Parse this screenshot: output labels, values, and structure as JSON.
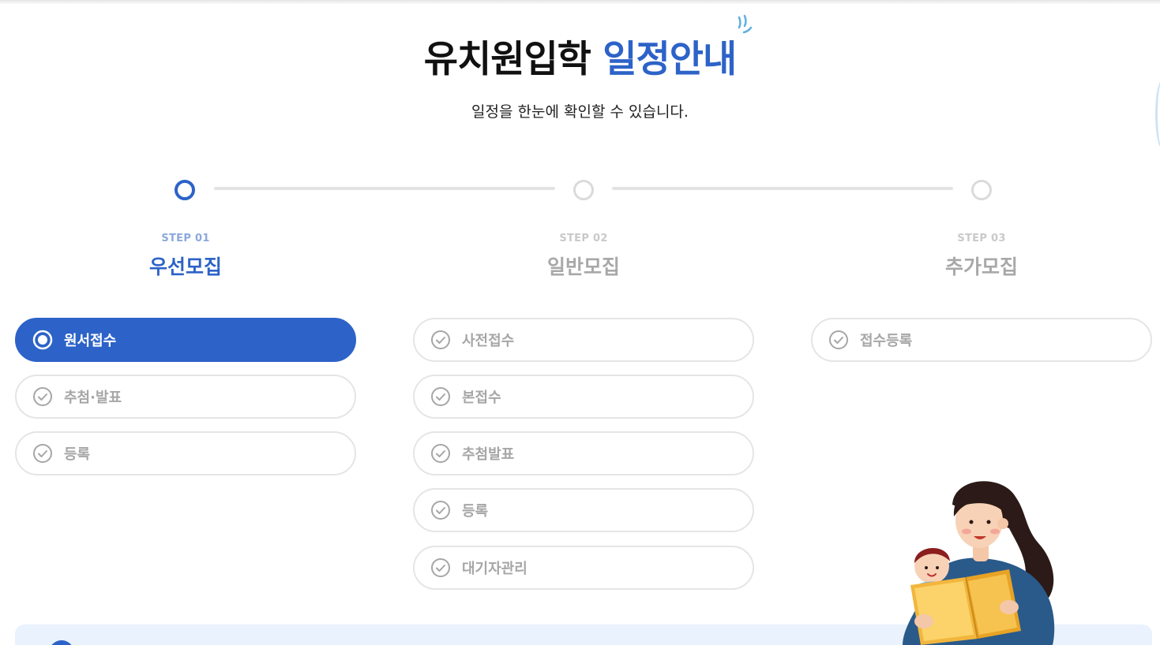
{
  "header": {
    "title_main": "유치원입학",
    "title_accent": "일정안내",
    "subtitle": "일정을 한눈에 확인할 수 있습니다."
  },
  "colors": {
    "accent": "#2d63c8",
    "inactive_text": "#a6a6a6",
    "border": "#e5e5e5",
    "panel": "#e9f2fd"
  },
  "steps": [
    {
      "number": "STEP 01",
      "name": "우선모집",
      "active": true,
      "items": [
        {
          "label": "원서접수",
          "active": true,
          "icon": "radio-selected-icon"
        },
        {
          "label": "추첨·발표",
          "active": false,
          "icon": "check-circle-icon"
        },
        {
          "label": "등록",
          "active": false,
          "icon": "check-circle-icon"
        }
      ]
    },
    {
      "number": "STEP 02",
      "name": "일반모집",
      "active": false,
      "items": [
        {
          "label": "사전접수",
          "active": false,
          "icon": "check-circle-icon"
        },
        {
          "label": "본접수",
          "active": false,
          "icon": "check-circle-icon"
        },
        {
          "label": "추첨발표",
          "active": false,
          "icon": "check-circle-icon"
        },
        {
          "label": "등록",
          "active": false,
          "icon": "check-circle-icon"
        },
        {
          "label": "대기자관리",
          "active": false,
          "icon": "check-circle-icon"
        }
      ]
    },
    {
      "number": "STEP 03",
      "name": "추가모집",
      "active": false,
      "items": [
        {
          "label": "접수등록",
          "active": false,
          "icon": "check-circle-icon"
        }
      ]
    }
  ]
}
